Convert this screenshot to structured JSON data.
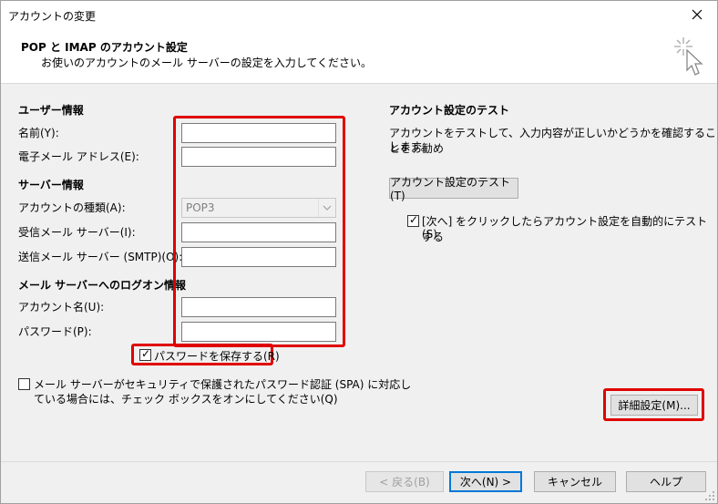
{
  "window": {
    "title": "アカウントの変更"
  },
  "header": {
    "title": "POP と IMAP のアカウント設定",
    "subtitle": "お使いのアカウントのメール サーバーの設定を入力してください。"
  },
  "user_info": {
    "heading": "ユーザー情報",
    "name_label": "名前(Y):",
    "name_value": "",
    "email_label": "電子メール アドレス(E):",
    "email_value": ""
  },
  "server_info": {
    "heading": "サーバー情報",
    "account_type_label": "アカウントの種類(A):",
    "account_type_value": "POP3",
    "incoming_label": "受信メール サーバー(I):",
    "incoming_value": "",
    "outgoing_label": "送信メール サーバー (SMTP)(O):",
    "outgoing_value": ""
  },
  "logon_info": {
    "heading": "メール サーバーへのログオン情報",
    "account_name_label": "アカウント名(U):",
    "account_name_value": "",
    "password_label": "パスワード(P):",
    "password_value": "",
    "remember_password_label": "パスワードを保存する(R)",
    "remember_password_checked": true,
    "spa_label_line1": "メール サーバーがセキュリティで保護されたパスワード認証 (SPA) に対応し",
    "spa_label_line2": "ている場合には、チェック ボックスをオンにしてください(Q)",
    "spa_checked": false
  },
  "test": {
    "heading": "アカウント設定のテスト",
    "description_line1": "アカウントをテストして、入力内容が正しいかどうかを確認することをお勧め",
    "description_line2": "します。",
    "test_button": "アカウント設定のテスト(T)",
    "auto_test_line1": "[次へ] をクリックしたらアカウント設定を自動的にテストする",
    "auto_test_line2": "(S)",
    "auto_test_checked": true
  },
  "more_settings_button": "詳細設定(M)...",
  "footer": {
    "back": "< 戻る(B)",
    "next": "次へ(N) >",
    "cancel": "キャンセル",
    "help": "ヘルプ"
  },
  "colors": {
    "highlight": "#e00000",
    "accent": "#0078d7"
  }
}
